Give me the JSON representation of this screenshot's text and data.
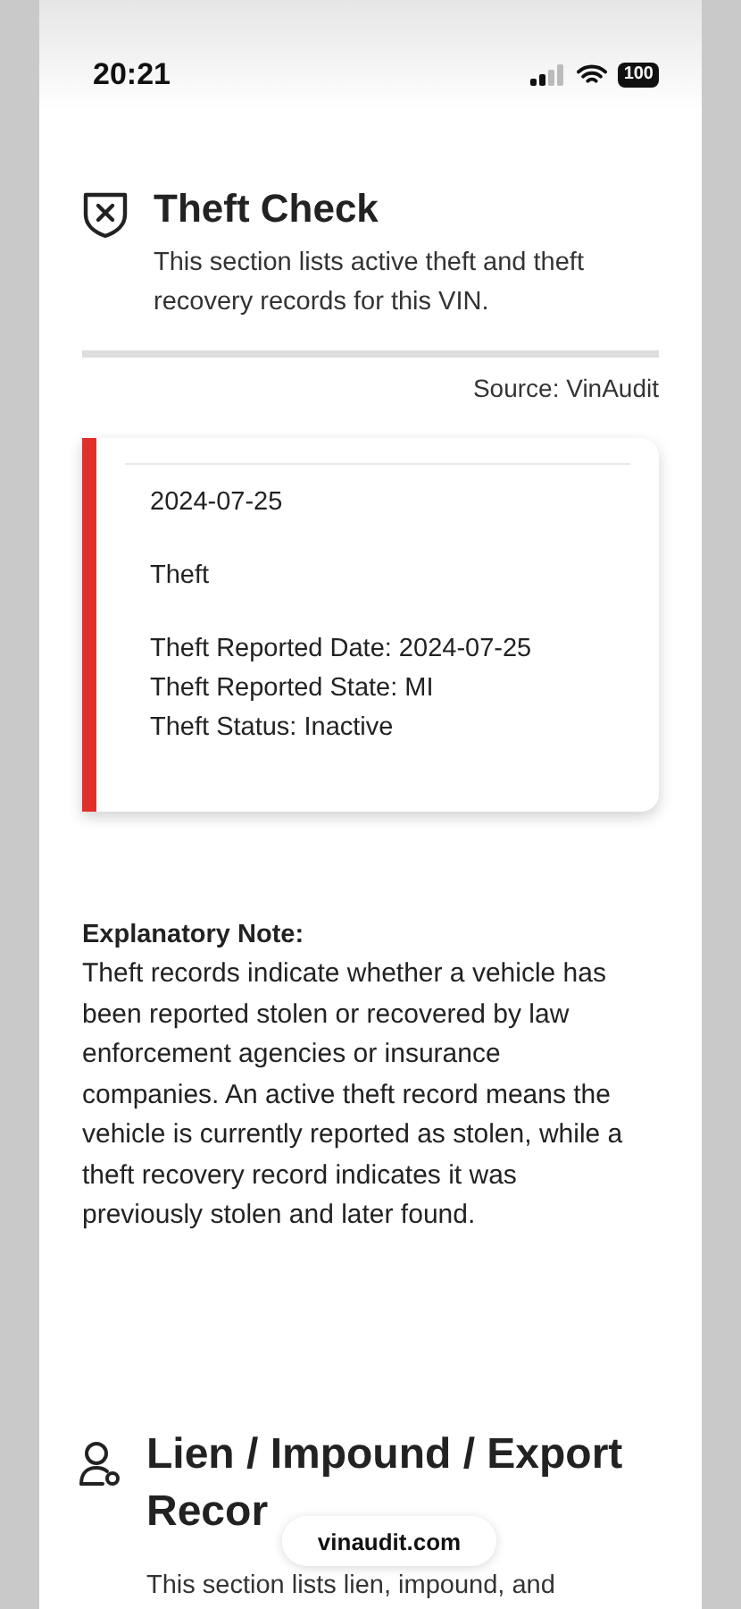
{
  "status_bar": {
    "time": "20:21",
    "battery": "100"
  },
  "theft_section": {
    "title": "Theft Check",
    "description": "This section lists active theft and theft recovery records for this VIN.",
    "source": "Source: VinAudit",
    "records": [
      {
        "date": "2024-07-25",
        "type": "Theft",
        "details": [
          "Theft Reported Date: 2024-07-25",
          "Theft Reported State: MI",
          "Theft Status: Inactive"
        ]
      }
    ],
    "note_title": "Explanatory Note:",
    "note": "Theft records indicate whether a vehicle has been reported stolen or recovered by law enforcement agencies or insurance companies. An active theft record means the vehicle is currently reported as stolen, while a theft recovery record indicates it was previously stolen and later found."
  },
  "lien_section": {
    "title_lines": [
      "Lien / Impound / Export",
      "Recor"
    ],
    "description": "This section lists lien, impound, and"
  },
  "address_bar": {
    "url": "vinaudit.com"
  }
}
